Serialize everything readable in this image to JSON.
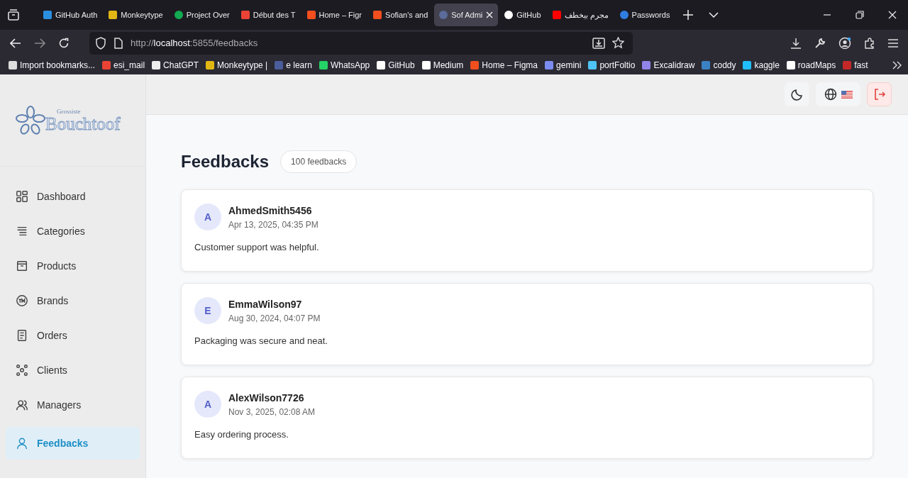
{
  "browser": {
    "tabs": [
      {
        "title": "GitHub Auth",
        "kind": "vscode",
        "selected": false
      },
      {
        "title": "Monkeytype",
        "kind": "monkeytype",
        "selected": false
      },
      {
        "title": "Project Over",
        "kind": "mongodb",
        "selected": false
      },
      {
        "title": "Début des T",
        "kind": "gmail",
        "selected": false
      },
      {
        "title": "Home – Figr",
        "kind": "figma",
        "selected": false
      },
      {
        "title": "Sofian's and",
        "kind": "figma",
        "selected": false
      },
      {
        "title": "Sof Admi",
        "kind": "react",
        "selected": true
      },
      {
        "title": "GitHub",
        "kind": "github",
        "selected": false
      },
      {
        "title": "مجرم بيخطف",
        "kind": "youtube",
        "selected": false
      },
      {
        "title": "Passwords",
        "kind": "firefox",
        "selected": false
      }
    ],
    "url_scheme": "http://",
    "url_host": "localhost",
    "url_rest": ":5855/feedbacks",
    "bookmarks": [
      {
        "title": "Import bookmarks...",
        "kind": "import"
      },
      {
        "title": "esi_mail",
        "kind": "gmail"
      },
      {
        "title": "ChatGPT",
        "kind": "chatgpt"
      },
      {
        "title": "Monkeytype |",
        "kind": "monkeytype"
      },
      {
        "title": "e learn",
        "kind": "elearn"
      },
      {
        "title": "WhatsApp",
        "kind": "whatsapp"
      },
      {
        "title": "GitHub",
        "kind": "github"
      },
      {
        "title": "Medium",
        "kind": "medium"
      },
      {
        "title": "Home – Figma",
        "kind": "figma"
      },
      {
        "title": "gemini",
        "kind": "gemini"
      },
      {
        "title": "portFoltio",
        "kind": "flutter"
      },
      {
        "title": "Excalidraw",
        "kind": "excalidraw"
      },
      {
        "title": "coddy",
        "kind": "coddy"
      },
      {
        "title": "kaggle",
        "kind": "kaggle"
      },
      {
        "title": "roadMaps",
        "kind": "roadmaps"
      },
      {
        "title": "fast",
        "kind": "fast"
      }
    ]
  },
  "sidebar": {
    "logo_top": "Grossiste",
    "logo_main": "Bouchtoof",
    "items": [
      {
        "label": "Dashboard",
        "kind": "dashboard",
        "selected": false
      },
      {
        "label": "Categories",
        "kind": "categories",
        "selected": false
      },
      {
        "label": "Products",
        "kind": "products",
        "selected": false
      },
      {
        "label": "Brands",
        "kind": "brands",
        "selected": false
      },
      {
        "label": "Orders",
        "kind": "orders",
        "selected": false
      },
      {
        "label": "Clients",
        "kind": "clients",
        "selected": false
      },
      {
        "label": "Managers",
        "kind": "managers",
        "selected": false
      },
      {
        "label": "Feedbacks",
        "kind": "feedbacks",
        "selected": true
      }
    ]
  },
  "page": {
    "title": "Feedbacks",
    "count": "100 feedbacks",
    "feedbacks": [
      {
        "initial": "A",
        "user": "AhmedSmith5456",
        "date": "Apr 13, 2025, 04:35 PM",
        "text": "Customer support was helpful."
      },
      {
        "initial": "E",
        "user": "EmmaWilson97",
        "date": "Aug 30, 2024, 04:07 PM",
        "text": "Packaging was secure and neat."
      },
      {
        "initial": "A",
        "user": "AlexWilson7726",
        "date": "Nov 3, 2025, 02:08 AM",
        "text": "Easy ordering process."
      }
    ]
  }
}
